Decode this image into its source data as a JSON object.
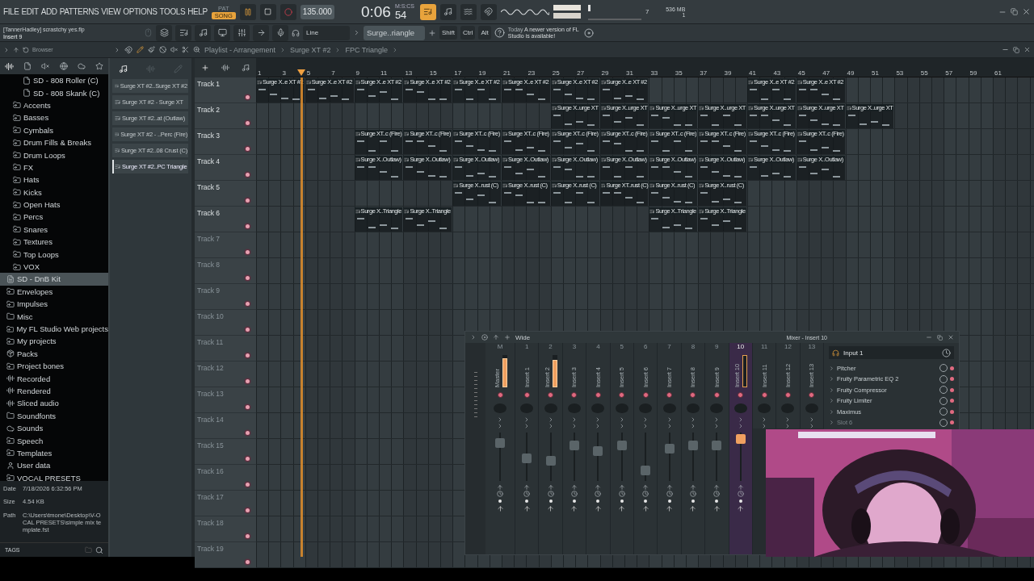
{
  "menu": [
    "FILE",
    "EDIT",
    "ADD",
    "PATTERNS",
    "VIEW",
    "OPTIONS",
    "TOOLS",
    "HELP"
  ],
  "transport": {
    "modes": [
      {
        "label": "PAT",
        "selected": false
      },
      {
        "label": "SONG",
        "selected": true
      }
    ],
    "playing": true,
    "tempo": "135.000",
    "time": "0:06",
    "time_cs": "54",
    "time_unit": "M:S:CS",
    "cpu": "7",
    "memory": "536 MB",
    "polyphony": "1"
  },
  "hint": {
    "title": "[TannerHadley] scrastchy yes.flp",
    "subtitle": "Insert 9"
  },
  "toolbar": {
    "record_source": "Line",
    "pattern": "Surge..riangle",
    "keys": [
      "Shift",
      "Ctrl",
      "Alt"
    ],
    "news_date": "Today",
    "news": "A newer version of FL Studio is available!"
  },
  "browser": {
    "title": "Browser",
    "items": [
      {
        "kind": "group",
        "children": [
          {
            "kind": "group",
            "children": [
              {
                "kind": "file",
                "label": "SD - 808 Roller (C)",
                "selected": false
              },
              {
                "kind": "file",
                "label": "SD - 808 Skank (C)",
                "selected": false
              }
            ]
          },
          {
            "kind": "folder",
            "label": "Accents",
            "selected": false
          },
          {
            "kind": "folder",
            "label": "Basses",
            "selected": false
          },
          {
            "kind": "folder",
            "label": "Cymbals",
            "selected": false
          },
          {
            "kind": "folder",
            "label": "Drum Fills & Breaks",
            "selected": false
          },
          {
            "kind": "folder",
            "label": "Drum Loops",
            "selected": false
          },
          {
            "kind": "folder",
            "label": "FX",
            "selected": false
          },
          {
            "kind": "folder",
            "label": "Hats",
            "selected": false
          },
          {
            "kind": "folder",
            "label": "Kicks",
            "selected": false
          },
          {
            "kind": "folder",
            "label": "Open Hats",
            "selected": false
          },
          {
            "kind": "folder",
            "label": "Percs",
            "selected": false
          },
          {
            "kind": "folder",
            "label": "Snares",
            "selected": false
          },
          {
            "kind": "folder",
            "label": "Textures",
            "selected": false
          },
          {
            "kind": "folder",
            "label": "Top Loops",
            "selected": false
          },
          {
            "kind": "folder",
            "label": "VOX",
            "selected": false
          }
        ]
      },
      {
        "kind": "pack",
        "label": "SD - DnB Kit",
        "selected": true
      },
      {
        "kind": "folder",
        "label": "Envelopes",
        "selected": false
      },
      {
        "kind": "folder",
        "label": "Impulses",
        "selected": false
      },
      {
        "kind": "plain",
        "label": "Misc",
        "selected": false
      },
      {
        "kind": "folder",
        "label": "My FL Studio Web projects",
        "selected": false
      },
      {
        "kind": "folder",
        "label": "My projects",
        "selected": false
      },
      {
        "kind": "packs",
        "label": "Packs",
        "selected": false
      },
      {
        "kind": "folder",
        "label": "Project bones",
        "selected": false
      },
      {
        "kind": "audio",
        "label": "Recorded",
        "selected": false
      },
      {
        "kind": "audio",
        "label": "Rendered",
        "selected": false
      },
      {
        "kind": "audio",
        "label": "Sliced audio",
        "selected": false
      },
      {
        "kind": "plain",
        "label": "Soundfonts",
        "selected": false
      },
      {
        "kind": "cloud",
        "label": "Sounds",
        "selected": false
      },
      {
        "kind": "folder",
        "label": "Speech",
        "selected": false
      },
      {
        "kind": "folder",
        "label": "Templates",
        "selected": false
      },
      {
        "kind": "user",
        "label": "User data",
        "selected": false
      },
      {
        "kind": "folder",
        "label": "VOCAL PRESETS",
        "selected": false
      }
    ],
    "info": [
      {
        "label": "Date",
        "value": "7/18/2026 6:32:56 PM"
      },
      {
        "label": "Size",
        "value": "4.54 KB"
      },
      {
        "label": "Path",
        "value": "C:\\Users\\tmone\\Desktop\\V-OCAL PRESETS\\simple mix template.fst"
      }
    ],
    "tags": "TAGS"
  },
  "playlist": {
    "breadcrumb": [
      "Playlist - Arrangement",
      "Surge XT #2",
      "FPC Triangle"
    ],
    "patterns": [
      {
        "label": "Surge XT #2..Surge XT #2",
        "selected": false
      },
      {
        "label": "Surge XT #2 - Surge XT",
        "selected": false
      },
      {
        "label": "Surge XT #2..at (Outlaw)",
        "selected": false
      },
      {
        "label": "Surge XT #2 - ..Perc (Fire)",
        "selected": false
      },
      {
        "label": "Surge XT #2..08 Crust (C)",
        "selected": false
      },
      {
        "label": "Surge XT #2..PC Triangle",
        "selected": true
      }
    ],
    "ruler": [
      "1",
      "3",
      "5",
      "7",
      "9",
      "11",
      "13",
      "15",
      "17",
      "19",
      "21",
      "23",
      "25",
      "27",
      "29",
      "31",
      "33",
      "35",
      "37",
      "39",
      "41",
      "43",
      "45",
      "47",
      "49",
      "51",
      "53",
      "55",
      "57",
      "59",
      "61"
    ],
    "playhead": {
      "level": 0.058
    },
    "tracks": [
      {
        "name": "Track 1",
        "active": true,
        "segments": [
          {
            "kind": "clip",
            "label": "Surge X..e XT #2"
          },
          {
            "kind": "clip",
            "label": "Surge X..e XT #2"
          },
          {
            "kind": "clip",
            "label": "Surge X..e XT #2"
          },
          {
            "kind": "clip",
            "label": "Surge X..e XT #2"
          },
          {
            "kind": "clip",
            "label": "Surge X..e XT #2"
          },
          {
            "kind": "clip",
            "label": "Surge X..e XT #2"
          },
          {
            "kind": "clip",
            "label": "Surge X..e XT #2"
          },
          {
            "kind": "clip",
            "label": "Surge X..e XT #2"
          },
          {
            "kind": "empty"
          },
          {
            "kind": "empty"
          },
          {
            "kind": "clip",
            "label": "Surge X..e XT #2"
          },
          {
            "kind": "clip",
            "label": "Surge X..e XT #2"
          }
        ]
      },
      {
        "name": "Track 2",
        "active": true,
        "segments": [
          {
            "kind": "empty"
          },
          {
            "kind": "empty"
          },
          {
            "kind": "empty"
          },
          {
            "kind": "empty"
          },
          {
            "kind": "empty"
          },
          {
            "kind": "empty"
          },
          {
            "kind": "clip",
            "label": "Surge X..urge XT"
          },
          {
            "kind": "clip",
            "label": "Surge X..urge XT"
          },
          {
            "kind": "clip",
            "label": "Surge X..urge XT"
          },
          {
            "kind": "clip",
            "label": "Surge X..urge XT"
          },
          {
            "kind": "clip",
            "label": "Surge X..urge XT"
          },
          {
            "kind": "clip",
            "label": "Surge X..urge XT"
          },
          {
            "kind": "clip",
            "label": "Surge X..urge XT"
          }
        ]
      },
      {
        "name": "Track 3",
        "active": true,
        "segments": [
          {
            "kind": "empty"
          },
          {
            "kind": "empty"
          },
          {
            "kind": "clip",
            "label": "Surge XT..c (Fire)"
          },
          {
            "kind": "clip",
            "label": "Surge XT..c (Fire)"
          },
          {
            "kind": "clip",
            "label": "Surge XT..c (Fire)"
          },
          {
            "kind": "clip",
            "label": "Surge XT..c (Fire)"
          },
          {
            "kind": "clip",
            "label": "Surge XT..c (Fire)"
          },
          {
            "kind": "clip",
            "label": "Surge XT..c (Fire)"
          },
          {
            "kind": "clip",
            "label": "Surge XT..c (Fire)"
          },
          {
            "kind": "clip",
            "label": "Surge XT..c (Fire)"
          },
          {
            "kind": "clip",
            "label": "Surge XT..c (Fire)"
          },
          {
            "kind": "clip",
            "label": "Surge XT..c (Fire)"
          }
        ]
      },
      {
        "name": "Track 4",
        "active": true,
        "segments": [
          {
            "kind": "empty"
          },
          {
            "kind": "empty"
          },
          {
            "kind": "clip",
            "label": "Surge X..Outlaw)"
          },
          {
            "kind": "clip",
            "label": "Surge X..Outlaw)"
          },
          {
            "kind": "clip",
            "label": "Surge X..Outlaw)"
          },
          {
            "kind": "clip",
            "label": "Surge X..Outlaw)"
          },
          {
            "kind": "clip",
            "label": "Surge X..Outlaw)"
          },
          {
            "kind": "clip",
            "label": "Surge X..Outlaw)"
          },
          {
            "kind": "clip",
            "label": "Surge X..Outlaw)"
          },
          {
            "kind": "clip",
            "label": "Surge X..Outlaw)"
          },
          {
            "kind": "clip",
            "label": "Surge X..Outlaw)"
          },
          {
            "kind": "clip",
            "label": "Surge X..Outlaw)"
          }
        ]
      },
      {
        "name": "Track 5",
        "active": true,
        "segments": [
          {
            "kind": "empty"
          },
          {
            "kind": "empty"
          },
          {
            "kind": "empty"
          },
          {
            "kind": "empty"
          },
          {
            "kind": "clip",
            "label": "Surge X..rust (C)"
          },
          {
            "kind": "clip",
            "label": "Surge X..rust (C)"
          },
          {
            "kind": "clip",
            "label": "Surge X..rust (C)"
          },
          {
            "kind": "clip",
            "label": "Surge XT..rust (C)"
          },
          {
            "kind": "clip",
            "label": "Surge X..rust (C)"
          },
          {
            "kind": "clip",
            "label": "Surge X..rust (C)"
          }
        ]
      },
      {
        "name": "Track 6",
        "active": true,
        "segments": [
          {
            "kind": "empty"
          },
          {
            "kind": "empty"
          },
          {
            "kind": "clip",
            "label": "Surge X..Triangle"
          },
          {
            "kind": "clip",
            "label": "Surge X..Triangle"
          },
          {
            "kind": "empty"
          },
          {
            "kind": "empty"
          },
          {
            "kind": "empty"
          },
          {
            "kind": "empty"
          },
          {
            "kind": "clip",
            "label": "Surge X..Triangle"
          },
          {
            "kind": "clip",
            "label": "Surge X..Triangle"
          }
        ]
      },
      {
        "name": "Track 7",
        "active": false
      },
      {
        "name": "Track 8",
        "active": false
      },
      {
        "name": "Track 9",
        "active": false
      },
      {
        "name": "Track 10",
        "active": false
      },
      {
        "name": "Track 11",
        "active": false
      },
      {
        "name": "Track 12",
        "active": false
      },
      {
        "name": "Track 13",
        "active": false
      },
      {
        "name": "Track 14",
        "active": false
      },
      {
        "name": "Track 15",
        "active": false
      },
      {
        "name": "Track 16",
        "active": false
      },
      {
        "name": "Track 17",
        "active": false
      },
      {
        "name": "Track 18",
        "active": false
      },
      {
        "name": "Track 19",
        "active": false
      }
    ]
  },
  "mixer": {
    "title": "Mixer - Insert 10",
    "preset": "Wide",
    "input": "Input 1",
    "strips": [
      {
        "number": "M",
        "name": "Master",
        "selected": false,
        "level": 0.85,
        "meter": {
          "level": 0.9
        }
      },
      {
        "number": "1",
        "name": "Insert 1",
        "selected": false,
        "level": 0.45
      },
      {
        "number": "2",
        "name": "Insert 2",
        "selected": false,
        "level": 0.4,
        "meter": {
          "level": 0.85
        }
      },
      {
        "number": "3",
        "name": "Insert 3",
        "selected": false,
        "level": 0.8
      },
      {
        "number": "4",
        "name": "Insert 4",
        "selected": false,
        "level": 0.65
      },
      {
        "number": "5",
        "name": "Insert 5",
        "selected": false,
        "level": 0.8
      },
      {
        "number": "6",
        "name": "Insert 6",
        "selected": false,
        "level": 0.15
      },
      {
        "number": "7",
        "name": "Insert 7",
        "selected": false,
        "level": 0.7
      },
      {
        "number": "8",
        "name": "Insert 8",
        "selected": false,
        "level": 0.8
      },
      {
        "number": "9",
        "name": "Insert 9",
        "selected": false,
        "level": 0.8
      },
      {
        "number": "10",
        "name": "Insert 10",
        "selected": true,
        "level": 0.95
      },
      {
        "number": "11",
        "name": "Insert 11",
        "selected": false
      },
      {
        "number": "12",
        "name": "Insert 12",
        "selected": false
      },
      {
        "number": "13",
        "name": "Insert 13",
        "selected": false
      }
    ],
    "slots": [
      {
        "name": "Pitcher",
        "empty": false
      },
      {
        "name": "Fruity Parametric EQ 2",
        "empty": false
      },
      {
        "name": "Fruity Compressor",
        "empty": false
      },
      {
        "name": "Fruity Limiter",
        "empty": false
      },
      {
        "name": "Maximus",
        "empty": false
      },
      {
        "name": "Slot 6",
        "empty": true
      }
    ]
  }
}
